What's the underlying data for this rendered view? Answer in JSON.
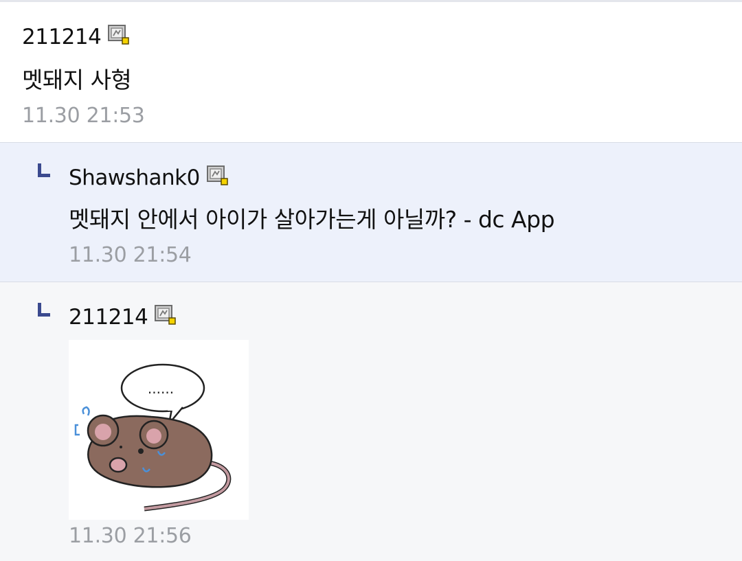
{
  "comments": [
    {
      "author": "211214",
      "author_icon": "mobile-user-icon",
      "content": "멧돼지 사형",
      "date": "11.30 21:53"
    },
    {
      "author": "Shawshank0",
      "author_icon": "mobile-user-icon",
      "content": "멧돼지 안에서 아이가 살아가는게 아닐까? - dc App",
      "date": "11.30 21:54",
      "is_reply": true
    },
    {
      "author": "211214",
      "author_icon": "mobile-user-icon",
      "sticker": "worried-mouse-sticker",
      "sticker_speech": "......",
      "date": "11.30 21:56",
      "is_reply": true
    }
  ],
  "colors": {
    "reply_highlight_bg": "#edf1fb",
    "reply_bg": "#f6f7f9",
    "date_text": "#9b9ea3",
    "reply_arrow": "#3b4a8f"
  }
}
